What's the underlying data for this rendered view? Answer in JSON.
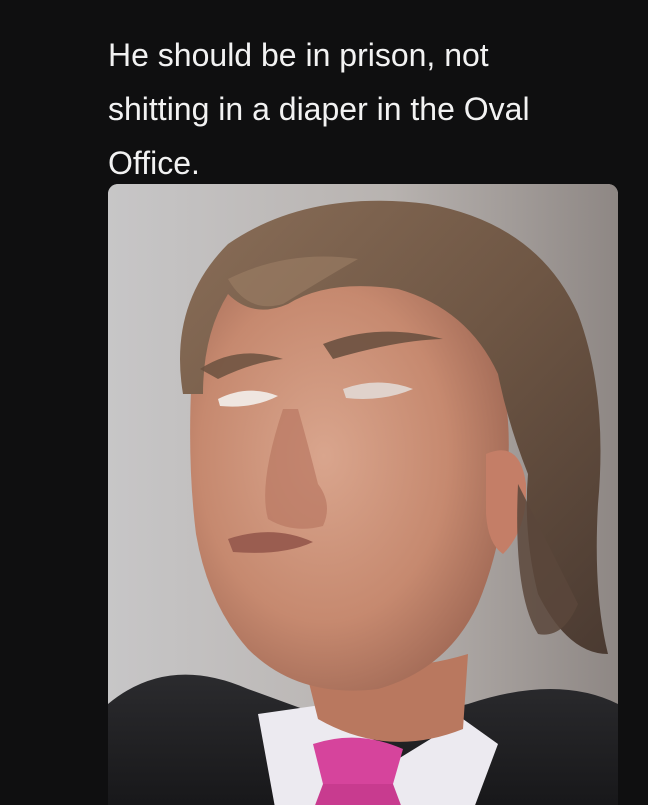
{
  "post": {
    "text": "He should be in prison, not shitting in a diaper in the Oval Office."
  },
  "media": {
    "kind": "photo",
    "background_color": "#0f0f10",
    "text_color": "#f2f2f2"
  }
}
